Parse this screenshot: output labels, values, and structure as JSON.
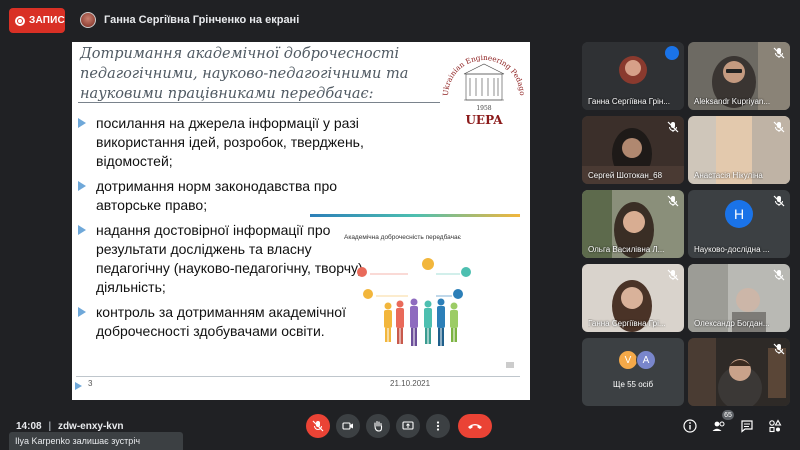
{
  "recording": {
    "label": "ЗАПИС"
  },
  "presenter": {
    "text": "Ганна Сергіївна Грінченко на екрані"
  },
  "slide": {
    "title_line1": "Дотримання академічної доброчесності",
    "title_line2": "педагогічними, науково-педагогічними та",
    "title_line3_plain": "науковими працівниками ",
    "title_line3_em": "передбачає:",
    "logo": {
      "org": "Ukrainian Engineering Pedagogics Academy",
      "year": "1958",
      "abbr": "UEPA"
    },
    "bullets": [
      "посилання на джерела інформації у разі використання ідей, розробок, тверджень, відомостей;",
      "дотримання норм законодавства про авторське право;",
      "надання достовірної інформації про результати досліджень та власну педагогічну (науково-педагогічну, творчу) діяльність;",
      "контроль за дотриманням академічної доброчесності здобувачами освіти."
    ],
    "inner_title": "Академічна доброчесність передбачає",
    "page_number": "3",
    "date": "21.10.2021"
  },
  "tiles": [
    {
      "name": "Ганна Сергіївна Грін...",
      "icon": "sound-indicator-icon"
    },
    {
      "name": "Aleksandr Kupriyan...",
      "icon": "mic-off-icon"
    },
    {
      "name": "Сергей Шотокан_68",
      "icon": "mic-off-icon"
    },
    {
      "name": "Анастасія Нікуліна",
      "icon": "mic-off-icon"
    },
    {
      "name": "Ольга Василівна Л...",
      "icon": "mic-off-icon"
    },
    {
      "name": "Науково-дослідна ...",
      "initial": "Н",
      "icon": "mic-off-icon"
    },
    {
      "name": "Ганна Сергіївна Грі...",
      "icon": "mic-off-icon"
    },
    {
      "name": "Олександр Богдан...",
      "icon": "mic-off-icon"
    },
    {
      "name": "Ще 55 осіб",
      "avatars": [
        "V",
        "A"
      ],
      "colors": [
        "#f4a949",
        "#7986cb"
      ]
    },
    {
      "name": "",
      "icon": "mic-off-icon"
    }
  ],
  "bottom": {
    "time": "14:08",
    "meeting_code": "zdw-enxy-kvn",
    "people_count": "65",
    "toast": "Ilya Karpenko залишає зустріч"
  },
  "colors": {
    "record_red": "#d93025",
    "accent_blue": "#1a73e8",
    "bg": "#202124",
    "hangup": "#ea4335"
  }
}
